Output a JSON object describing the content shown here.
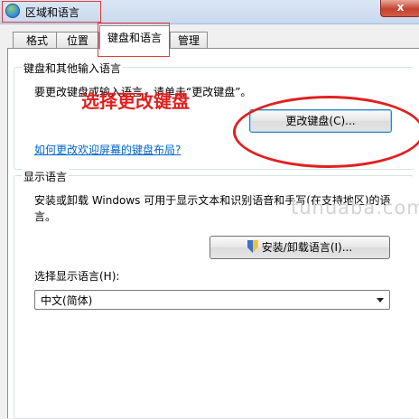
{
  "window": {
    "title": "区域和语言",
    "close_label": "x"
  },
  "tabs": [
    {
      "label": "格式",
      "active": false
    },
    {
      "label": "位置",
      "active": false
    },
    {
      "label": "键盘和语言",
      "active": true
    },
    {
      "label": "管理",
      "active": false
    }
  ],
  "keyboard_group": {
    "title": "键盘和其他输入语言",
    "description": "要更改键盘或输入语言，请单击“更改键盘”。",
    "change_button": "更改键盘(C)...",
    "link": "如何更改欢迎屏幕的键盘布局?"
  },
  "display_group": {
    "title": "显示语言",
    "description_line1": "安装或卸载 Windows 可用于显示文本和识别语音和手写(在支持地区)的语",
    "description_line2": "言。",
    "install_button": "安装/卸载语言(I)...",
    "select_label": "选择显示语言(H):",
    "select_value": "中文(简体)"
  },
  "annotation": {
    "text": "选择更改键盘",
    "color": "#e21f1f"
  },
  "watermark": "tuhuaba.com",
  "icons": [
    "globe-icon",
    "shield-icon",
    "dropdown-arrow-icon"
  ]
}
